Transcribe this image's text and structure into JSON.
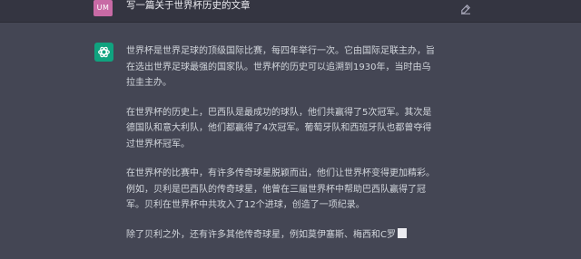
{
  "user_message": {
    "avatar_initials": "UM",
    "text": "写一篇关于世界杯历史的文章"
  },
  "assistant_message": {
    "paragraphs": [
      "世界杯是世界足球的顶级国际比赛，每四年举行一次。它由国际足联主办，旨\n在选出世界足球最强的国家队。世界杯的历史可以追溯到1930年，当时由乌\n拉圭主办。",
      "在世界杯的历史上，巴西队是最成功的球队，他们共赢得了5次冠军。其次是\n德国队和意大利队，他们都赢得了4次冠军。葡萄牙队和西班牙队也都曾夺得\n过世界杯冠军。",
      "在世界杯的比赛中，有许多传奇球星脱颖而出，他们让世界杯变得更加精彩。\n例如，贝利是巴西队的传奇球星，他曾在三届世界杯中帮助巴西队赢得了冠\n军。贝利在世界杯中共攻入了12个进球，创造了一项纪录。",
      "除了贝利之外，还有许多其他传奇球星，例如莫伊塞斯、梅西和C罗"
    ]
  },
  "colors": {
    "user_bg": "#343541",
    "assistant_bg": "#444654",
    "user_avatar": "#c86aa5",
    "assistant_avatar": "#10a37f",
    "text": "#d1d5db"
  }
}
